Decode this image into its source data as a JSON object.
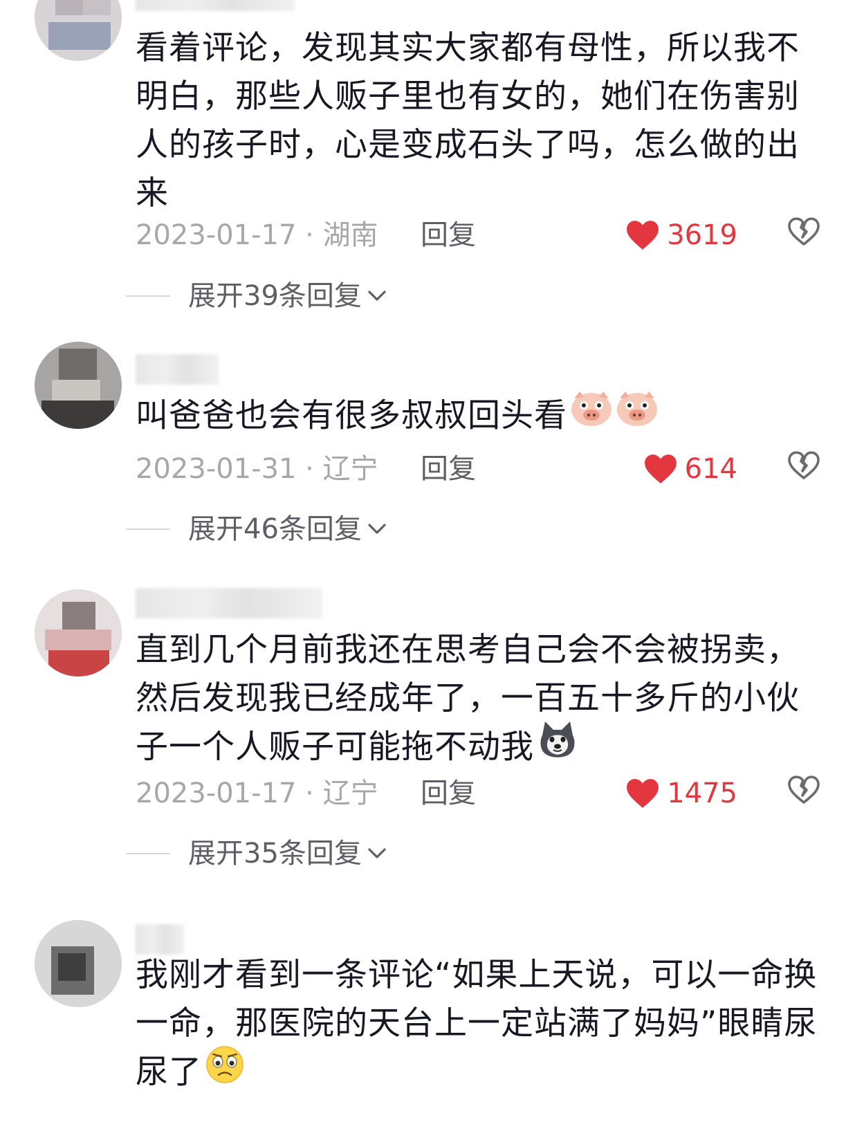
{
  "comments": [
    {
      "text": "看着评论，发现其实大家都有母性，所以我不明白，那些人贩子里也有女的，她们在伤害别人的孩子时，心是变成石头了吗，怎么做的出来",
      "date_loc": "2023-01-17 · 湖南",
      "reply_label": "回复",
      "likes": "3619",
      "expand_label": "展开39条回复"
    },
    {
      "text": "叫爸爸也会有很多叔叔回头看",
      "date_loc": "2023-01-31 · 辽宁",
      "reply_label": "回复",
      "likes": "614",
      "expand_label": "展开46条回复",
      "emojis": [
        "pig-face",
        "pig-face"
      ]
    },
    {
      "text": "直到几个月前我还在思考自己会不会被拐卖，然后发现我已经成年了，一百五十多斤的小伙子一个人贩子可能拖不动我",
      "date_loc": "2023-01-17 · 辽宁",
      "reply_label": "回复",
      "likes": "1475",
      "expand_label": "展开35条回复",
      "emojis": [
        "husky-dog"
      ]
    },
    {
      "text": "我刚才看到一条评论“如果上天说，可以一命换一命，那医院的天台上一定站满了妈妈”眼睛尿尿了",
      "emojis": [
        "worried-face"
      ]
    }
  ],
  "icons": {
    "like": "heart-icon",
    "dislike": "broken-heart-icon",
    "expand": "chevron-down-icon"
  },
  "colors": {
    "like": "#e3363f",
    "meta": "#a6a7ab",
    "reply": "#5d5e66"
  }
}
